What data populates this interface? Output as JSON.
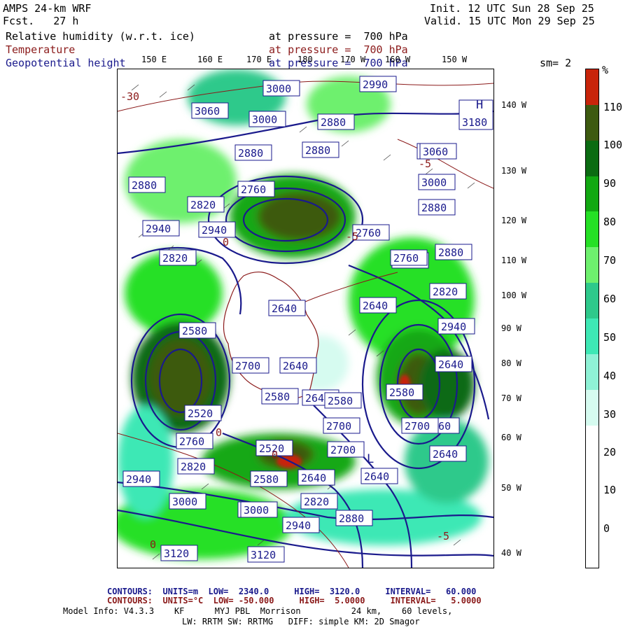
{
  "header": {
    "model": "AMPS 24-km WRF",
    "fcst": "Fcst.   27 h",
    "init": "Init. 12 UTC Sun 28 Sep 25",
    "valid": "Valid. 15 UTC Mon 29 Sep 25"
  },
  "fields": [
    {
      "name": "Relative humidity (w.r.t. ice)",
      "level": "at pressure =  700 hPa",
      "color": "#000000"
    },
    {
      "name": "Temperature",
      "level": "at pressure =  700 hPa",
      "color": "#8b1a1a"
    },
    {
      "name": "Geopotential height",
      "level": "at pressure =  700 hPa",
      "color": "#1a1a8c"
    }
  ],
  "smoothing": "sm= 2",
  "colorbar": {
    "unit": "%",
    "labels": [
      "110",
      "100",
      "90",
      "80",
      "70",
      "60",
      "50",
      "40",
      "30",
      "20",
      "10",
      "0"
    ],
    "colors": [
      "#c8240a",
      "#3d5a10",
      "#0b6b12",
      "#12a812",
      "#25e025",
      "#6ef06e",
      "#2ec98b",
      "#3ee8b5",
      "#8ff2d6",
      "#d6fbf0",
      "#ffffff",
      "#ffffff",
      "#ffffff",
      "#ffffff"
    ]
  },
  "map": {
    "lon_labels": [
      "150 E",
      "160 E",
      "170 E",
      "180",
      "170 W",
      "160 W",
      "150 W"
    ],
    "lat_labels": [
      "140 W",
      "130 W",
      "120 W",
      "110 W",
      "100 W",
      "90 W",
      "80 W",
      "70 W",
      "60 W",
      "50 W",
      "40 W"
    ],
    "height_labels": [
      "3060",
      "3000",
      "3000",
      "2990",
      "2880",
      "3120",
      "3180",
      "2880",
      "2820",
      "2880",
      "2760",
      "2880",
      "3060",
      "2880",
      "2940",
      "2940",
      "2820",
      "2760",
      "2700",
      "2640",
      "2580",
      "2520",
      "2700",
      "2640",
      "2760",
      "2580",
      "2640",
      "2700",
      "2760",
      "2820",
      "2940",
      "3000",
      "3060",
      "3120",
      "2520",
      "2580",
      "2640",
      "2700",
      "2580",
      "2640",
      "2940",
      "2880",
      "2820",
      "3000",
      "3120",
      "2640",
      "2580",
      "2640",
      "2700",
      "2640",
      "2760",
      "2820",
      "2880",
      "2940",
      "3000",
      "3060",
      "3120"
    ],
    "temp_labels": [
      "-5",
      "-5",
      "-5",
      "0",
      "0",
      "0",
      "0",
      "-30"
    ],
    "lows": [
      "L"
    ],
    "highs": [
      "H"
    ]
  },
  "footer": {
    "line1": "CONTOURS:  UNITS=m  LOW=  2340.0     HIGH=  3120.0     INTERVAL=   60.000",
    "line2": "CONTOURS:  UNITS=°C  LOW= -50.000     HIGH=  5.0000     INTERVAL=   5.0000",
    "line3": "Model Info: V4.3.3    KF      MYJ PBL  Morrison          24 km,    60 levels,",
    "line4": "LW: RRTM SW: RRTMG   DIFF: simple KM: 2D Smagor"
  }
}
